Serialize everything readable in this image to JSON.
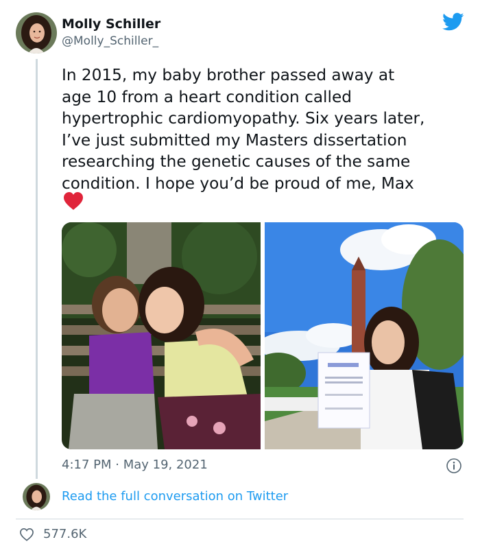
{
  "author": {
    "display_name": "Molly Schiller",
    "handle": "@Molly_Schiller_"
  },
  "tweet": {
    "text": "In 2015, my baby brother passed away at\nage 10 from a heart condition called\nhypertrophic cardiomyopathy. Six years later,\nI’ve just submitted my Masters dissertation\nresearching the genetic causes of the same\ncondition. I hope you’d be proud of me, Max",
    "emoji": "red-heart",
    "timestamp": "4:17 PM · May 19, 2021"
  },
  "footer": {
    "read_link": "Read the full conversation on Twitter",
    "like_count": "577.6K"
  },
  "icons": {
    "brand": "twitter-bird-icon",
    "info": "info-icon",
    "like": "heart-outline-icon"
  },
  "colors": {
    "accent": "#1d9bf0",
    "text": "#0f1419",
    "secondary": "#536471",
    "heart_emoji": "#e0243a"
  }
}
